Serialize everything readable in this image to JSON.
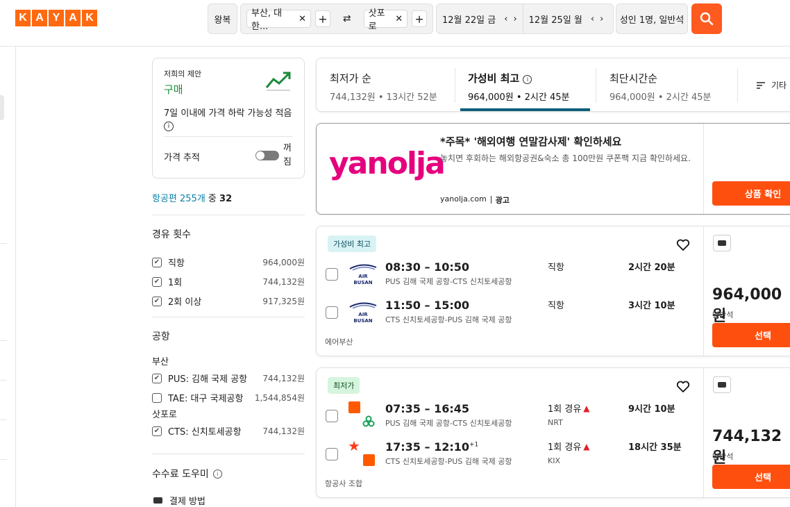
{
  "brand": {
    "logo_letters": [
      "K",
      "A",
      "Y",
      "A",
      "K"
    ],
    "accent": "#ff690f"
  },
  "search": {
    "trip_type": "왕복",
    "origin": "부산, 대한...",
    "destination": "삿포로",
    "depart_date": "12월 22일 금",
    "return_date": "12월 25일 월",
    "travelers": "성인 1명, 일반석"
  },
  "deal": {
    "title": "저희의 제안",
    "action": "구매",
    "desc": "7일 이내에 가격 하락 가능성 적음",
    "track_label": "가격 추적",
    "toggle_label": "꺼짐"
  },
  "results_count": {
    "prefix": "항공편 255개",
    "middle": " 중 ",
    "shown": "32"
  },
  "filters": {
    "stops_title": "경유 횟수",
    "stops": [
      {
        "label": "직항",
        "price": "964,000원"
      },
      {
        "label": "1회",
        "price": "744,132원"
      },
      {
        "label": "2회 이상",
        "price": "917,325원"
      }
    ],
    "airports_title": "공항",
    "group_busan": "부산",
    "busan": [
      {
        "label": "PUS: 김해 국제 공항",
        "price": "744,132원",
        "checked": true
      },
      {
        "label": "TAE: 대구 국제공항",
        "price": "1,544,854원",
        "checked": false
      }
    ],
    "group_sapporo": "삿포로",
    "sapporo": [
      {
        "label": "CTS: 신치토세공항",
        "price": "744,132원",
        "checked": true
      }
    ],
    "fee_title": "수수료 도우미",
    "payment_label": "결제 방법"
  },
  "sort": {
    "tabs": [
      {
        "label": "최저가 순",
        "sub": "744,132원 • 13시간 52분"
      },
      {
        "label": "가성비 최고",
        "sub": "964,000원 • 2시간 45분"
      },
      {
        "label": "최단시간순",
        "sub": "964,000원 • 2시간 45분"
      }
    ],
    "more": "기타"
  },
  "ad": {
    "brand": "yanolja",
    "headline": "*주목* '해외여행 연말감사제' 확인하세요",
    "body": "놓치면 후회하는 해외항공권&숙소 총 100만원 쿠폰팩 지금 확인하세요.",
    "domain": "yanolja.com",
    "ad_label": "광고",
    "cta": "상품 확인",
    "brand_color": "#e5007e"
  },
  "results": [
    {
      "badge": "가성비 최고",
      "legs": [
        {
          "time": "08:30 – 10:50",
          "sup": "",
          "route": "PUS 김해 국제 공항-CTS 신치토세공항",
          "stops": "직항",
          "via": "",
          "duration": "2시간 20분",
          "airline_logo": "AIR BUSAN"
        },
        {
          "time": "11:50 – 15:00",
          "sup": "",
          "route": "CTS 신치토세공항-PUS 김해 국제 공항",
          "stops": "직항",
          "via": "",
          "duration": "3시간 10분",
          "airline_logo": "AIR BUSAN"
        }
      ],
      "airline": "에어부산",
      "price": "964,000원",
      "cabin": "일반석",
      "select": "선택"
    },
    {
      "badge": "최저가",
      "legs": [
        {
          "time": "07:35 – 16:45",
          "sup": "",
          "route": "PUS 김해 국제 공항-CTS 신치토세공항",
          "stops": "1회 경유",
          "via": "NRT",
          "duration": "9시간 10분"
        },
        {
          "time": "17:35 – 12:10",
          "sup": "+1",
          "route": "CTS 신치토세공항-PUS 김해 국제 공항",
          "stops": "1회 경유",
          "via": "KIX",
          "duration": "18시간 35분"
        }
      ],
      "airline": "항공사 조합",
      "price": "744,132원",
      "cabin": "일반석",
      "select": "선택"
    }
  ]
}
